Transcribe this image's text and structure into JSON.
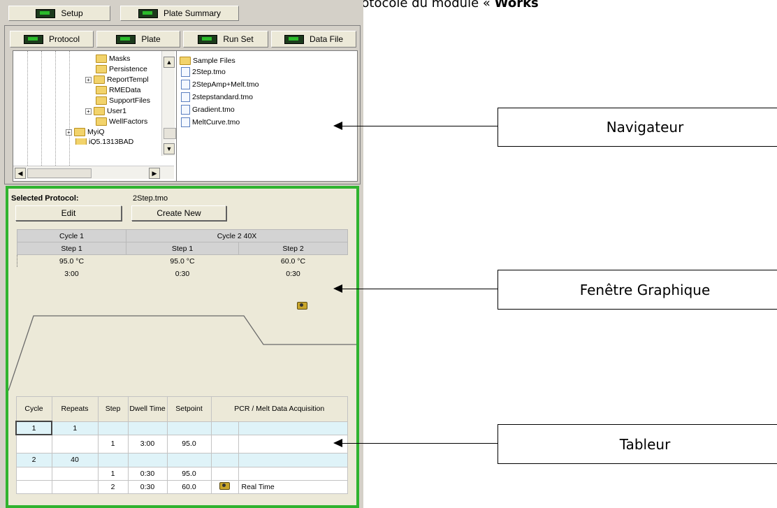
{
  "caption": {
    "text_plain": "Sélectionnés, Crées, Edités à partir du visualisateur de protocole du module « ",
    "text_bold": "Works"
  },
  "top_tabs": [
    "Setup",
    "Plate Summary"
  ],
  "sub_tabs": [
    "Protocol",
    "Plate",
    "Run Set",
    "Data File"
  ],
  "tree": {
    "folders": [
      "Masks",
      "Persistence",
      "ReportTempl",
      "RMEData",
      "SupportFiles",
      "User1",
      "WellFactors",
      "MyiQ",
      "iQ5.1313BAD"
    ]
  },
  "files": [
    "Sample Files",
    "2Step.tmo",
    "2StepAmp+Melt.tmo",
    "2stepstandard.tmo",
    "Gradient.tmo",
    "MeltCurve.tmo"
  ],
  "selected_protocol": {
    "label": "Selected Protocol:",
    "value": "2Step.tmo"
  },
  "buttons": {
    "edit": "Edit",
    "create_new": "Create New"
  },
  "protocol_table": {
    "cycle1": "Cycle 1",
    "cycle2": "Cycle 2 40X",
    "steps": [
      "Step 1",
      "Step 1",
      "Step 2"
    ],
    "temps": [
      "95.0 °C",
      "95.0 °C",
      "60.0 °C"
    ],
    "times": [
      "3:00",
      "0:30",
      "0:30"
    ]
  },
  "grid": {
    "headers": [
      "Cycle",
      "Repeats",
      "Step",
      "Dwell Time",
      "Setpoint",
      "PCR / Melt Data Acquisition"
    ],
    "rows": [
      {
        "type": "cycle",
        "cycle": "1",
        "repeats": "1",
        "step": "",
        "dwell": "",
        "setpoint": "",
        "acq": ""
      },
      {
        "type": "step",
        "cycle": "",
        "repeats": "",
        "step": "1",
        "dwell": "3:00",
        "setpoint": "95.0",
        "acq": ""
      },
      {
        "type": "cycle",
        "cycle": "2",
        "repeats": "40",
        "step": "",
        "dwell": "",
        "setpoint": "",
        "acq": ""
      },
      {
        "type": "step",
        "cycle": "",
        "repeats": "",
        "step": "1",
        "dwell": "0:30",
        "setpoint": "95.0",
        "acq": ""
      },
      {
        "type": "step",
        "cycle": "",
        "repeats": "",
        "step": "2",
        "dwell": "0:30",
        "setpoint": "60.0",
        "acq": "Real Time"
      }
    ]
  },
  "callouts": [
    "Navigateur",
    "Fenêtre Graphique",
    "Tableur"
  ]
}
